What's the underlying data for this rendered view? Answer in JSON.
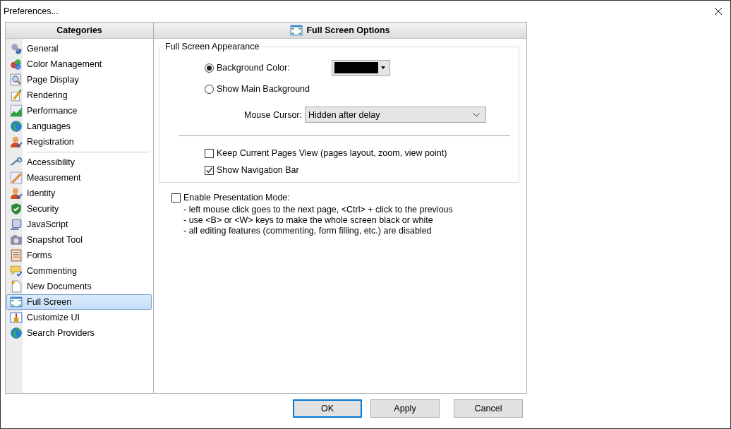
{
  "window": {
    "title": "Preferences..."
  },
  "sidebar": {
    "heading": "Categories",
    "groups": [
      {
        "items": [
          {
            "label": "General",
            "selected": false
          },
          {
            "label": "Color Management",
            "selected": false
          },
          {
            "label": "Page Display",
            "selected": false
          },
          {
            "label": "Rendering",
            "selected": false
          },
          {
            "label": "Performance",
            "selected": false
          },
          {
            "label": "Languages",
            "selected": false
          },
          {
            "label": "Registration",
            "selected": false
          }
        ]
      },
      {
        "items": [
          {
            "label": "Accessibility",
            "selected": false
          },
          {
            "label": "Measurement",
            "selected": false
          },
          {
            "label": "Identity",
            "selected": false
          },
          {
            "label": "Security",
            "selected": false
          },
          {
            "label": "JavaScript",
            "selected": false
          },
          {
            "label": "Snapshot Tool",
            "selected": false
          },
          {
            "label": "Forms",
            "selected": false
          },
          {
            "label": "Commenting",
            "selected": false
          },
          {
            "label": "New Documents",
            "selected": false
          },
          {
            "label": "Full Screen",
            "selected": true
          },
          {
            "label": "Customize UI",
            "selected": false
          },
          {
            "label": "Search Providers",
            "selected": false
          }
        ]
      }
    ]
  },
  "panel": {
    "heading": "Full Screen Options",
    "appearance": {
      "title": "Full Screen Appearance",
      "radios": [
        {
          "label": "Background Color:",
          "selected": true
        },
        {
          "label": "Show Main Background",
          "selected": false
        }
      ],
      "background_color": {
        "color": "#000000"
      },
      "mouse_cursor": {
        "label": "Mouse Cursor:",
        "value": "Hidden after delay"
      },
      "checkboxes": [
        {
          "label": "Keep Current Pages View (pages layout, zoom, view point)",
          "checked": false
        },
        {
          "label": "Show Navigation Bar",
          "checked": true
        }
      ]
    },
    "presentation": {
      "label": "Enable Presentation Mode:",
      "checked": false,
      "notes": [
        "- left mouse click goes to the next page, <Ctrl> + click to the previous",
        "- use <B> or <W> keys to make the whole screen black or white",
        "- all editing features (commenting, form filling, etc.) are disabled"
      ]
    }
  },
  "buttons": [
    {
      "label": "OK",
      "selected": true
    },
    {
      "label": "Apply",
      "selected": false
    },
    {
      "label": "Cancel",
      "selected": false
    }
  ]
}
